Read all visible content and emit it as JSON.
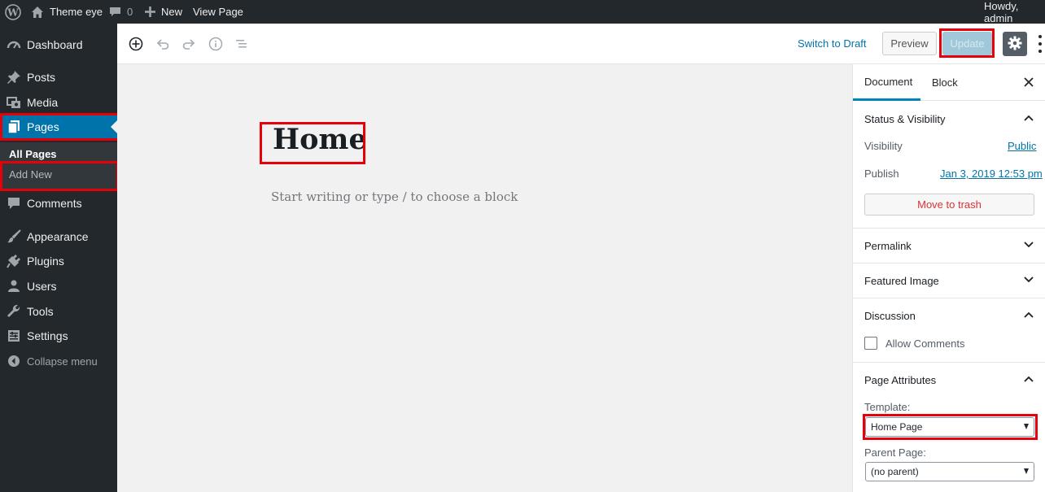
{
  "adminbar": {
    "site_name": "Theme eye",
    "comments_count": "0",
    "new_label": "New",
    "view_page_label": "View Page",
    "greeting": "Howdy, admin"
  },
  "sidebar": {
    "items": [
      {
        "label": "Dashboard",
        "icon": "dashboard-icon"
      },
      {
        "label": "Posts",
        "icon": "pin-icon"
      },
      {
        "label": "Media",
        "icon": "media-icon"
      },
      {
        "label": "Pages",
        "icon": "pages-icon",
        "current": true
      },
      {
        "label": "Comments",
        "icon": "comment-icon"
      },
      {
        "label": "Appearance",
        "icon": "brush-icon"
      },
      {
        "label": "Plugins",
        "icon": "plug-icon"
      },
      {
        "label": "Users",
        "icon": "user-icon"
      },
      {
        "label": "Tools",
        "icon": "wrench-icon"
      },
      {
        "label": "Settings",
        "icon": "settings-icon"
      },
      {
        "label": "Collapse menu",
        "icon": "collapse-icon"
      }
    ],
    "submenu": [
      {
        "label": "All Pages"
      },
      {
        "label": "Add New"
      }
    ]
  },
  "header": {
    "switch_to_draft": "Switch to Draft",
    "preview": "Preview",
    "update": "Update"
  },
  "editor": {
    "title": "Home",
    "placeholder": "Start writing or type / to choose a block"
  },
  "panel": {
    "tabs": [
      "Document",
      "Block"
    ],
    "status": {
      "title": "Status & Visibility",
      "visibility_label": "Visibility",
      "visibility_value": "Public",
      "publish_label": "Publish",
      "publish_value": "Jan 3, 2019 12:53 pm",
      "trash": "Move to trash"
    },
    "permalink": "Permalink",
    "featured_image": "Featured Image",
    "discussion": {
      "title": "Discussion",
      "allow_comments": "Allow Comments",
      "allow_comments_checked": false
    },
    "page_attributes": {
      "title": "Page Attributes",
      "template_label": "Template:",
      "template_value": "Home Page",
      "parent_label": "Parent Page:",
      "parent_value": "(no parent)"
    }
  },
  "colors": {
    "admin_dark": "#23282d",
    "accent": "#0073aa",
    "highlight": "#e6000a",
    "trash_red": "#dc3232"
  }
}
